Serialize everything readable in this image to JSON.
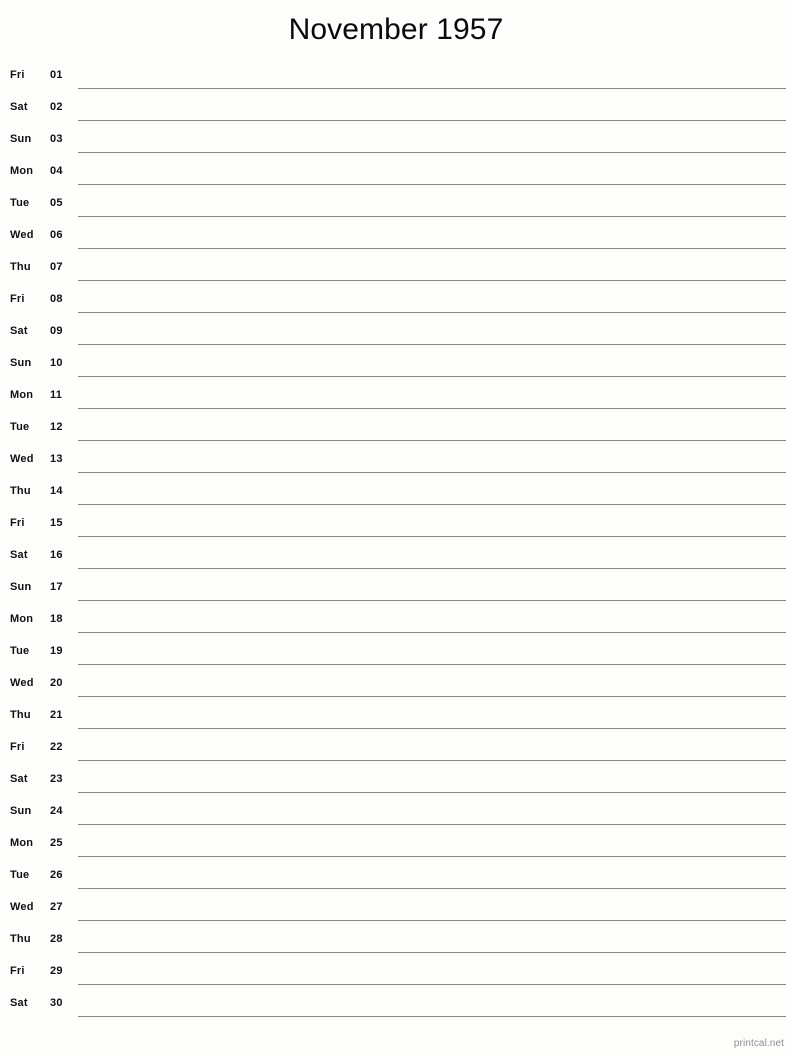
{
  "page": {
    "title": "November 1957",
    "background_color": "#fdfdfb",
    "text_color": "#111111",
    "rule_color": "#8a8a85",
    "footer_color": "#8e8e8e"
  },
  "footer": {
    "credit": "printcal.net"
  },
  "days": [
    {
      "weekday": "Fri",
      "number": "01"
    },
    {
      "weekday": "Sat",
      "number": "02"
    },
    {
      "weekday": "Sun",
      "number": "03"
    },
    {
      "weekday": "Mon",
      "number": "04"
    },
    {
      "weekday": "Tue",
      "number": "05"
    },
    {
      "weekday": "Wed",
      "number": "06"
    },
    {
      "weekday": "Thu",
      "number": "07"
    },
    {
      "weekday": "Fri",
      "number": "08"
    },
    {
      "weekday": "Sat",
      "number": "09"
    },
    {
      "weekday": "Sun",
      "number": "10"
    },
    {
      "weekday": "Mon",
      "number": "11"
    },
    {
      "weekday": "Tue",
      "number": "12"
    },
    {
      "weekday": "Wed",
      "number": "13"
    },
    {
      "weekday": "Thu",
      "number": "14"
    },
    {
      "weekday": "Fri",
      "number": "15"
    },
    {
      "weekday": "Sat",
      "number": "16"
    },
    {
      "weekday": "Sun",
      "number": "17"
    },
    {
      "weekday": "Mon",
      "number": "18"
    },
    {
      "weekday": "Tue",
      "number": "19"
    },
    {
      "weekday": "Wed",
      "number": "20"
    },
    {
      "weekday": "Thu",
      "number": "21"
    },
    {
      "weekday": "Fri",
      "number": "22"
    },
    {
      "weekday": "Sat",
      "number": "23"
    },
    {
      "weekday": "Sun",
      "number": "24"
    },
    {
      "weekday": "Mon",
      "number": "25"
    },
    {
      "weekday": "Tue",
      "number": "26"
    },
    {
      "weekday": "Wed",
      "number": "27"
    },
    {
      "weekday": "Thu",
      "number": "28"
    },
    {
      "weekday": "Fri",
      "number": "29"
    },
    {
      "weekday": "Sat",
      "number": "30"
    }
  ]
}
